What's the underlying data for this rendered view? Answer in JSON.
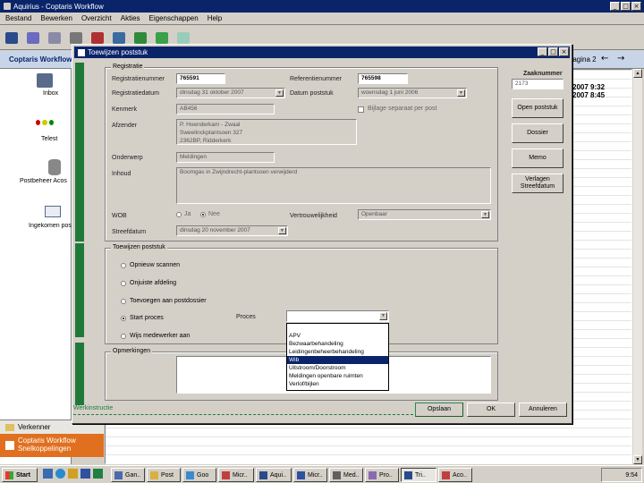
{
  "app": {
    "title": "Aquirius - Coptaris Workflow"
  },
  "menu": [
    "Bestand",
    "Bewerken",
    "Overzicht",
    "Akties",
    "Eigenschappen",
    "Help"
  ],
  "app_header": "Coptaris Workflow",
  "header_right_label": "Pagina 2",
  "sidebar": {
    "items": [
      {
        "label": "Inbox",
        "icon": "inbox-icon"
      },
      {
        "label": "Telest",
        "icon": "traffic-light-icon"
      },
      {
        "label": "Postbeheer Acos",
        "icon": "database-icon"
      },
      {
        "label": "Ingekomen post",
        "icon": "envelope-icon"
      }
    ],
    "bottom": [
      {
        "label": "Verkenner"
      },
      {
        "label": "Coptaris Workflow Snelkoppelingen"
      }
    ]
  },
  "right_panel": {
    "rows": [
      "2007 9:32",
      "2007 8:45"
    ]
  },
  "dialog": {
    "title": "Toewijzen poststuk",
    "registratie": {
      "title": "Registratie",
      "registratienummer_label": "Registratienummer",
      "registratienummer": "765591",
      "referentienummer_label": "Referentienummer",
      "referentienummer": "765598",
      "registratiedatum_label": "Registratiedatum",
      "registratiedatum": "dinsdag   31  oktober  2007",
      "datum_poststuk_label": "Datum poststuk",
      "datum_poststuk": "woensdag  1   juni   2006",
      "kenmerk_label": "Kenmerk",
      "kenmerk": "AB456",
      "bijlage_label": "Bijlage separaat per post",
      "afzender_label": "Afzender",
      "afzender_lines": [
        "P. Hoenderkam - Zwaal",
        "Sweelinckplantsoen 327",
        "2362BP, Ridderkerk"
      ],
      "onderwerp_label": "Onderwerp",
      "onderwerp": "Meldingen",
      "inhoud_label": "Inhoud",
      "inhoud": "Boomgas in Zwijndrecht-plantsoen verwijderd",
      "wob_label": "WOB",
      "ja_label": "Ja",
      "nee_label": "Nee",
      "vertrouwelijkheid_label": "Vertrouwelijkheid",
      "vertrouwelijkheid": "Openbaar",
      "streefdatum_label": "Streefdatum",
      "streefdatum": "dinsdag  20 november  2007"
    },
    "toewijzen": {
      "title": "Toewijzen poststuk",
      "options": [
        "Opnieuw scannen",
        "Onjuiste afdeling",
        "Toevoegen aan postdossier",
        "Start proces",
        "Wijs medewerker aan"
      ],
      "selected_index": 3,
      "proces_label": "Proces",
      "proces_value": "",
      "proces_options": [
        "APV",
        "Bezwaarbehandeling",
        "Leidingenbeheerbehandeling",
        "Wib",
        "Uitstroom/Doorstroom",
        "Meldingen openbare ruimten",
        "Verlof/bijlen"
      ],
      "highlighted_option": 3
    },
    "opmerkingen": {
      "title": "Opmerkingen",
      "text": ""
    },
    "werkinstructie": "Werkinstructie",
    "buttons": {
      "opslaan": "Opslaan",
      "ok": "OK",
      "annuleren": "Annuleren"
    },
    "side": {
      "zaaknummer_label": "Zaaknummer",
      "zaaknummer": "2173",
      "open_poststuk": "Open poststuk",
      "dossier": "Dossier",
      "memo": "Memo",
      "verlengen": "Verlagen Streefdatum"
    }
  },
  "taskbar": {
    "start": "Start",
    "items": [
      "Gan..",
      "Post",
      "Goo",
      "Micr..",
      "Aqui..",
      "Micr..",
      "Med..",
      "Pro..",
      "Tri..",
      "Aco.."
    ],
    "active_index": 8,
    "clock": "9:54"
  }
}
